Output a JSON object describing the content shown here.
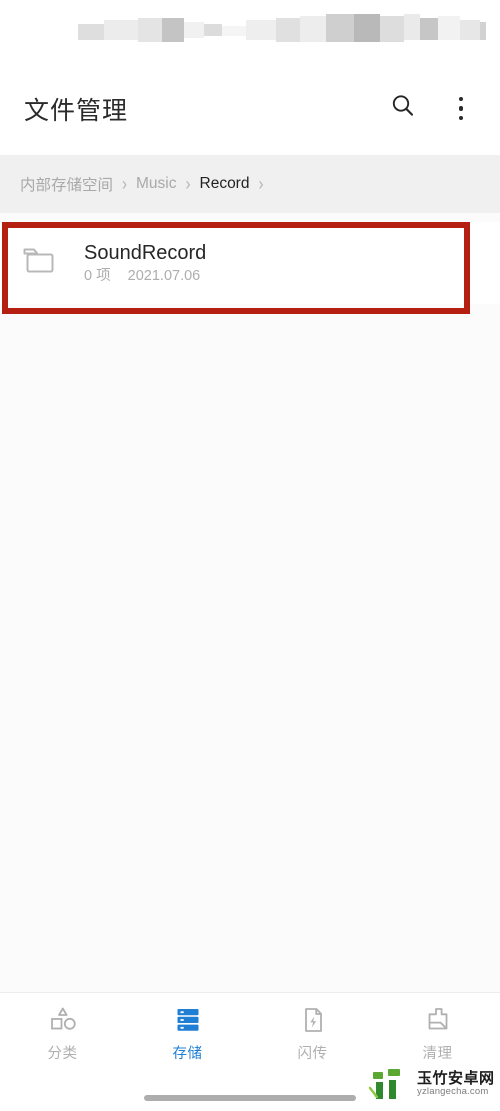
{
  "window": {
    "app_title": "文件管理"
  },
  "statusbar": {
    "redacted": true,
    "note": ""
  },
  "appbar": {
    "title": "文件管理",
    "actions": [
      {
        "name": "search-icon",
        "label": "搜索"
      },
      {
        "name": "more-options-icon",
        "label": "更多"
      }
    ]
  },
  "breadcrumb": {
    "separator": "›",
    "items": [
      {
        "label": "内部存储空间",
        "current": false
      },
      {
        "label": "Music",
        "current": false
      },
      {
        "label": "Record",
        "current": true
      }
    ],
    "trailing_separator": "›"
  },
  "file_list": {
    "items": [
      {
        "name": "SoundRecord",
        "icon": "folder-icon",
        "count": "0 项",
        "date": "2021.07.06",
        "highlighted": true
      }
    ]
  },
  "highlight": {
    "color": "#b51f11",
    "border_width": "6px"
  },
  "bottom_nav": {
    "active_index": 1,
    "active_color": "#1f7fd4",
    "inactive_color": "#b0b0b0",
    "items": [
      {
        "label": "分类",
        "icon": "shapes-category-icon"
      },
      {
        "label": "存储",
        "icon": "storage-stack-icon"
      },
      {
        "label": "闪传",
        "icon": "flash-transfer-icon"
      },
      {
        "label": "清理",
        "icon": "broom-clean-icon"
      }
    ]
  },
  "watermark": {
    "cn": "玉竹安卓网",
    "en": "yzlangecha.com"
  },
  "home_indicator": {
    "visible": true
  }
}
